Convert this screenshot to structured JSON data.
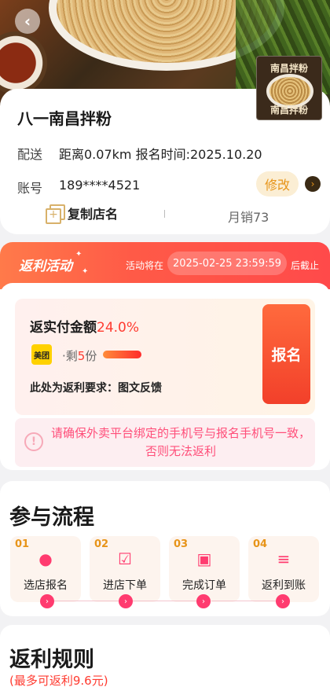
{
  "header": {
    "back_icon": "chevron-left-icon",
    "thumb_text_top": "南昌拌粉",
    "thumb_text_bottom": "南昌拌粉"
  },
  "store": {
    "name": "八一南昌拌粉",
    "delivery_label": "配送",
    "delivery_value": "距离0.07km 报名时间:2025.10.20",
    "account_label": "账号",
    "account_value": "189****4521",
    "edit_label": "修改",
    "copy_label": "复制店名",
    "monthly_sales": "月销73"
  },
  "rebate": {
    "title": "返利活动",
    "ends_prefix": "活动将在",
    "ends_time": "2025-02-25 23:59:59",
    "ends_suffix": "后截止",
    "amount_label": "返实付金额",
    "amount_value": "24.0%",
    "platform": "美团",
    "remain_prefix": "·剩",
    "remain_count": "5",
    "remain_suffix": "份",
    "remain_fraction": 0.7,
    "requirement": "此处为返利要求：图文反馈",
    "signup_label": "报名",
    "notice": "请确保外卖平台绑定的手机号与报名手机号一致，否则无法返利"
  },
  "process": {
    "title": "参与流程",
    "steps": [
      {
        "num": "01",
        "label": "选店报名",
        "icon": "user-icon"
      },
      {
        "num": "02",
        "label": "进店下单",
        "icon": "clipboard-check-icon"
      },
      {
        "num": "03",
        "label": "完成订单",
        "icon": "shopping-bag-icon"
      },
      {
        "num": "04",
        "label": "返利到账",
        "icon": "coins-icon"
      }
    ]
  },
  "rules": {
    "title": "返利规则",
    "subtitle": "(最多可返利9.6元)"
  },
  "colors": {
    "accent_red": "#ff3b30",
    "accent_pink": "#ff3b6f",
    "accent_gold": "#e79419",
    "header_gradient_start": "#ff7a4a",
    "header_gradient_end": "#ff4a4a"
  }
}
